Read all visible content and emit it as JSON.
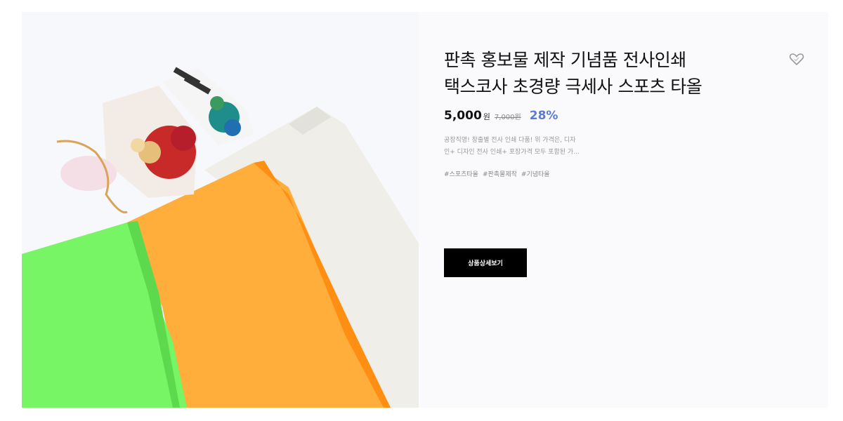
{
  "product": {
    "title_line1": "판촉 홍보물 제작 기념품 전사인쇄",
    "title_line2": "택스코사 초경량 극세사 스포츠 타올",
    "price": "5,000",
    "price_unit": "원",
    "original_price": "7,000원",
    "discount": "28%",
    "description_line1": "공장직영! 창출별 전사 인쇄 다품! 위 가격은, 디자",
    "description_line2": "인+ 디자인 전사 인쇄+ 포장가격 모두 포함된 가...",
    "tags": [
      "#스포츠타올",
      "#판촉물제작",
      "#기념타올"
    ],
    "detail_button_label": "상품상세보기",
    "wishlist_icon": "heart-icon"
  },
  "colors": {
    "accent_discount": "#5b7bd5",
    "button_bg": "#000000",
    "card_bg": "#fafafc",
    "towel_green": "#77f565",
    "towel_orange": "#ffad3b",
    "towel_white": "#efeee8"
  }
}
